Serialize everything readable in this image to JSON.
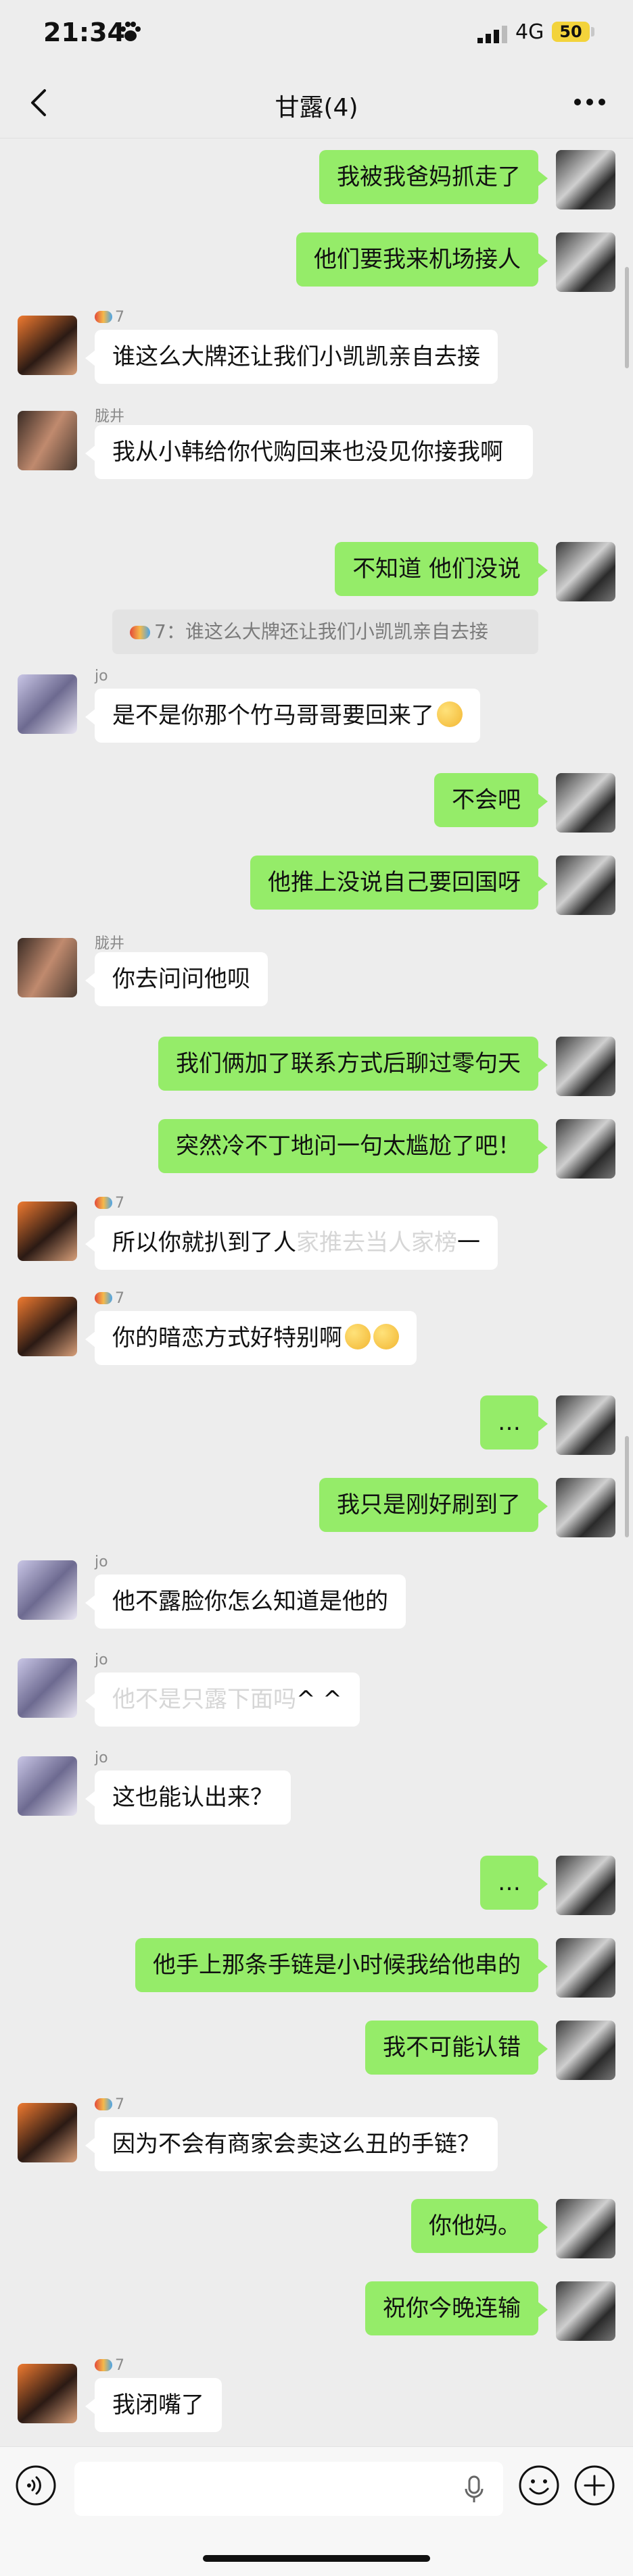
{
  "status_bar": {
    "time": "21:34",
    "network": "4G",
    "battery": "50"
  },
  "header": {
    "title": "甘露(4)"
  },
  "messages": [
    {
      "from": "me",
      "text": "我被我爸妈抓走了"
    },
    {
      "from": "me",
      "text": "他们要我来机场接人"
    },
    {
      "from": "7",
      "sender": "7",
      "text": "谁这么大牌还让我们小凯凯亲自去接"
    },
    {
      "from": "ljing",
      "sender": "胧井",
      "text": "我从小韩给你代购回来也没见你接我啊"
    },
    {
      "from": "me",
      "text": "不知道 他们没说"
    },
    {
      "from": "jo",
      "sender": "jo",
      "text": "是不是你那个竹马哥哥要回来了"
    },
    {
      "from": "me",
      "text": "不会吧"
    },
    {
      "from": "me",
      "text": "他推上没说自己要回国呀"
    },
    {
      "from": "ljing",
      "sender": "胧井",
      "text": "你去问问他呗"
    },
    {
      "from": "me",
      "text": "我们俩加了联系方式后聊过零句天"
    },
    {
      "from": "me",
      "text": "突然冷不丁地问一句太尴尬了吧！"
    },
    {
      "from": "7",
      "sender": "7",
      "text": "所以你就扒到了人",
      "faded_text": "家推去当人家榜",
      "text_end": "一"
    },
    {
      "from": "7",
      "sender": "7",
      "text": "你的暗恋方式好特别啊"
    },
    {
      "from": "me",
      "text": "…"
    },
    {
      "from": "me",
      "text": "我只是刚好刷到了"
    },
    {
      "from": "jo",
      "sender": "jo",
      "text": "他不露脸你怎么知道是他的"
    },
    {
      "from": "jo",
      "sender": "jo",
      "text": "",
      "faded_text": "他不是只露下面吗",
      "text_end": "^ ^"
    },
    {
      "from": "jo",
      "sender": "jo",
      "text": "这也能认出来？"
    },
    {
      "from": "me",
      "text": "…"
    },
    {
      "from": "me",
      "text": "他手上那条手链是小时候我给他串的"
    },
    {
      "from": "me",
      "text": "我不可能认错"
    },
    {
      "from": "7",
      "sender": "7",
      "text": "因为不会有商家会卖这么丑的手链？"
    },
    {
      "from": "me",
      "text": "你他妈。"
    },
    {
      "from": "me",
      "text": "祝你今晚连输"
    },
    {
      "from": "7",
      "sender": "7",
      "text": "我闭嘴了"
    }
  ],
  "quote": {
    "sender": "7",
    "text": "7：谁这么大牌还让我们小凯凯亲自去接"
  },
  "input": {
    "value": "",
    "placeholder": ""
  },
  "colors": {
    "me_bubble": "#95ec69",
    "other_bubble": "#ffffff",
    "background": "#ededed"
  }
}
